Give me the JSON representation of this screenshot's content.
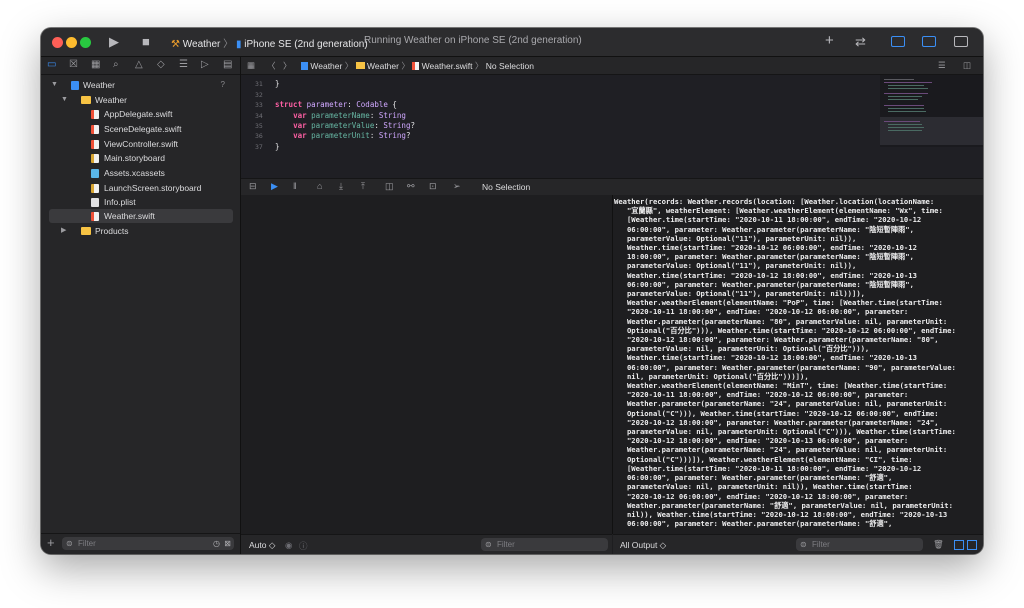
{
  "toolbar": {
    "scheme_target": "Weather",
    "scheme_device": "iPhone SE (2nd generation)",
    "activity": "Running Weather on iPhone SE (2nd generation)",
    "icons": [
      "play-icon",
      "stop-icon",
      "plus-icon",
      "arrows-swap-icon",
      "navigator-toggle-icon",
      "debug-area-toggle-icon",
      "inspector-toggle-icon"
    ]
  },
  "navigator": {
    "tabs": [
      "folder-icon",
      "source-control-icon",
      "symbol-icon",
      "search-icon",
      "issue-icon",
      "test-icon",
      "debug-icon",
      "breakpoint-icon",
      "report-icon"
    ],
    "project": "Weather",
    "project_badge": "?",
    "group": "Weather",
    "files": [
      {
        "name": "AppDelegate.swift",
        "kind": "swift"
      },
      {
        "name": "SceneDelegate.swift",
        "kind": "swift"
      },
      {
        "name": "ViewController.swift",
        "kind": "swift"
      },
      {
        "name": "Main.storyboard",
        "kind": "storyboard"
      },
      {
        "name": "Assets.xcassets",
        "kind": "assets"
      },
      {
        "name": "LaunchScreen.storyboard",
        "kind": "storyboard"
      },
      {
        "name": "Info.plist",
        "kind": "plist"
      },
      {
        "name": "Weather.swift",
        "kind": "swift",
        "selected": true
      }
    ],
    "products": "Products",
    "filter_placeholder": "Filter"
  },
  "jumpbar": {
    "crumbs": [
      "Weather",
      "Weather",
      "Weather.swift",
      "No Selection"
    ]
  },
  "editor": {
    "lines": [
      {
        "n": "31",
        "text": "}"
      },
      {
        "n": "32",
        "text": ""
      },
      {
        "n": "33",
        "text": "struct parameter: Codable {"
      },
      {
        "n": "34",
        "text": "    var parameterName: String"
      },
      {
        "n": "35",
        "text": "    var parameterValue: String?"
      },
      {
        "n": "36",
        "text": "    var parameterUnit: String?"
      },
      {
        "n": "37",
        "text": "}"
      }
    ],
    "line_top": "30"
  },
  "debugbar": {
    "selection": "No Selection"
  },
  "variables": {
    "scope": "Auto ◇",
    "filter_placeholder": "Filter"
  },
  "console": {
    "output_mode": "All Output ◇",
    "filter_placeholder": "Filter",
    "text": "Weather(records: Weather.records(location: [Weather.location(locationName:\n   \"宜蘭縣\", weatherElement: [Weather.weatherElement(elementName: \"Wx\", time:\n   [Weather.time(startTime: \"2020-10-11 18:00:00\", endTime: \"2020-10-12\n   06:00:00\", parameter: Weather.parameter(parameterName: \"陰短暫陣雨\",\n   parameterValue: Optional(\"11\"), parameterUnit: nil)),\n   Weather.time(startTime: \"2020-10-12 06:00:00\", endTime: \"2020-10-12\n   18:00:00\", parameter: Weather.parameter(parameterName: \"陰短暫陣雨\",\n   parameterValue: Optional(\"11\"), parameterUnit: nil)),\n   Weather.time(startTime: \"2020-10-12 18:00:00\", endTime: \"2020-10-13\n   06:00:00\", parameter: Weather.parameter(parameterName: \"陰短暫陣雨\",\n   parameterValue: Optional(\"11\"), parameterUnit: nil))]),\n   Weather.weatherElement(elementName: \"PoP\", time: [Weather.time(startTime:\n   \"2020-10-11 18:00:00\", endTime: \"2020-10-12 06:00:00\", parameter:\n   Weather.parameter(parameterName: \"80\", parameterValue: nil, parameterUnit:\n   Optional(\"百分比\"))), Weather.time(startTime: \"2020-10-12 06:00:00\", endTime:\n   \"2020-10-12 18:00:00\", parameter: Weather.parameter(parameterName: \"80\",\n   parameterValue: nil, parameterUnit: Optional(\"百分比\"))),\n   Weather.time(startTime: \"2020-10-12 18:00:00\", endTime: \"2020-10-13\n   06:00:00\", parameter: Weather.parameter(parameterName: \"90\", parameterValue:\n   nil, parameterUnit: Optional(\"百分比\")))]),\n   Weather.weatherElement(elementName: \"MinT\", time: [Weather.time(startTime:\n   \"2020-10-11 18:00:00\", endTime: \"2020-10-12 06:00:00\", parameter:\n   Weather.parameter(parameterName: \"24\", parameterValue: nil, parameterUnit:\n   Optional(\"C\"))), Weather.time(startTime: \"2020-10-12 06:00:00\", endTime:\n   \"2020-10-12 18:00:00\", parameter: Weather.parameter(parameterName: \"24\",\n   parameterValue: nil, parameterUnit: Optional(\"C\"))), Weather.time(startTime:\n   \"2020-10-12 18:00:00\", endTime: \"2020-10-13 06:00:00\", parameter:\n   Weather.parameter(parameterName: \"24\", parameterValue: nil, parameterUnit:\n   Optional(\"C\")))]), Weather.weatherElement(elementName: \"CI\", time:\n   [Weather.time(startTime: \"2020-10-11 18:00:00\", endTime: \"2020-10-12\n   06:00:00\", parameter: Weather.parameter(parameterName: \"舒適\",\n   parameterValue: nil, parameterUnit: nil)), Weather.time(startTime:\n   \"2020-10-12 06:00:00\", endTime: \"2020-10-12 18:00:00\", parameter:\n   Weather.parameter(parameterName: \"舒適\", parameterValue: nil, parameterUnit:\n   nil)), Weather.time(startTime: \"2020-10-12 18:00:00\", endTime: \"2020-10-13\n   06:00:00\", parameter: Weather.parameter(parameterName: \"舒適\","
  },
  "colors": {
    "accent": "#3b8ff5",
    "keyword": "#fc5fa3",
    "type": "#d0a8ff",
    "property": "#67b7a4"
  }
}
